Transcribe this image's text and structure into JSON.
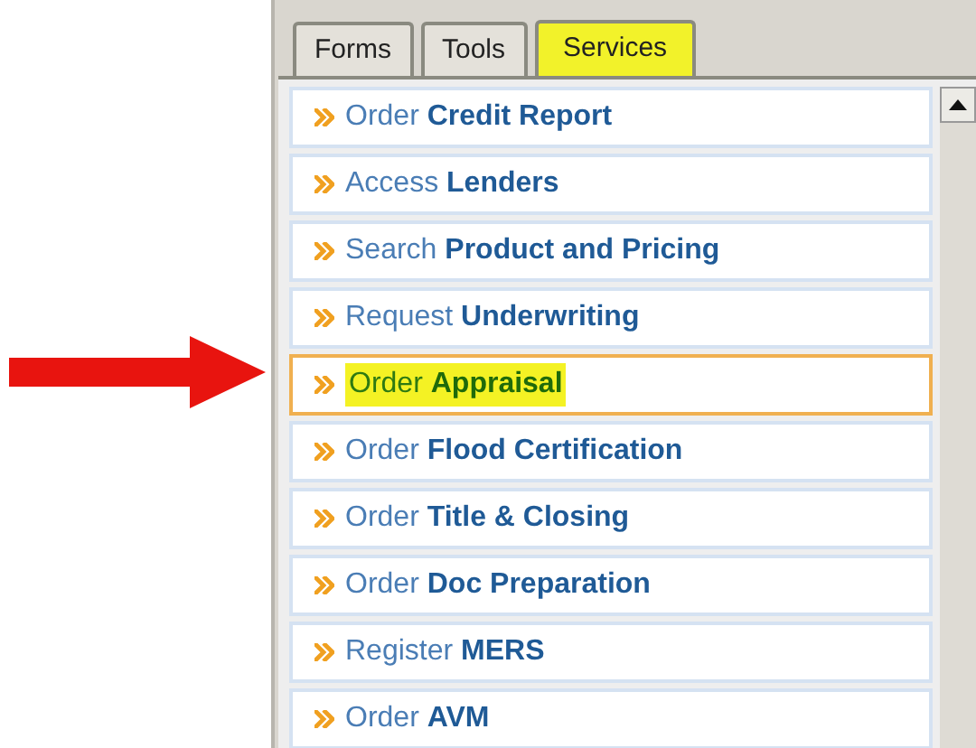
{
  "tabs": [
    {
      "label": "Forms",
      "selected": false
    },
    {
      "label": "Tools",
      "selected": false
    },
    {
      "label": "Services",
      "selected": true
    }
  ],
  "services": [
    {
      "verb": "Order",
      "noun": "Credit Report",
      "selected": false
    },
    {
      "verb": "Access",
      "noun": "Lenders",
      "selected": false
    },
    {
      "verb": "Search",
      "noun": "Product and Pricing",
      "selected": false
    },
    {
      "verb": "Request",
      "noun": "Underwriting",
      "selected": false
    },
    {
      "verb": "Order",
      "noun": "Appraisal",
      "selected": true
    },
    {
      "verb": "Order",
      "noun": "Flood Certification",
      "selected": false
    },
    {
      "verb": "Order",
      "noun": "Title & Closing",
      "selected": false
    },
    {
      "verb": "Order",
      "noun": "Doc Preparation",
      "selected": false
    },
    {
      "verb": "Register",
      "noun": "MERS",
      "selected": false
    },
    {
      "verb": "Order",
      "noun": "AVM",
      "selected": false
    }
  ]
}
